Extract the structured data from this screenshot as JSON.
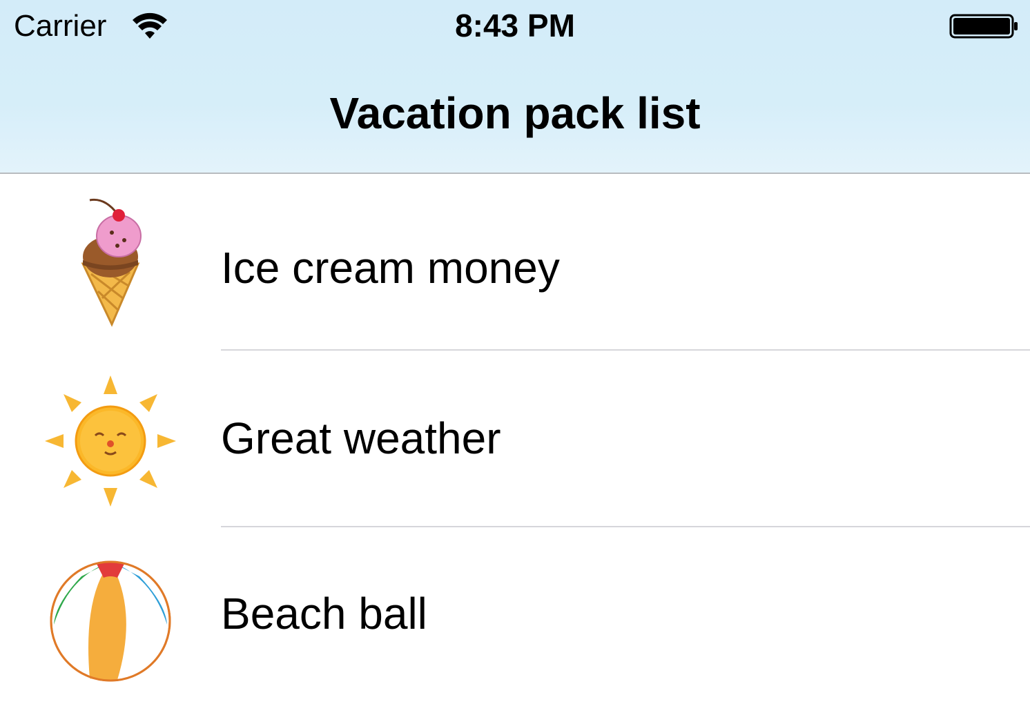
{
  "status_bar": {
    "carrier": "Carrier",
    "time": "8:43 PM",
    "wifi_icon": "wifi-icon",
    "battery_icon": "battery-icon"
  },
  "nav": {
    "title": "Vacation pack list"
  },
  "list": {
    "items": [
      {
        "label": "Ice cream money",
        "icon": "ice-cream-icon"
      },
      {
        "label": "Great weather",
        "icon": "sun-icon"
      },
      {
        "label": "Beach ball",
        "icon": "beach-ball-icon"
      }
    ]
  },
  "colors": {
    "nav_background": "#d3ecf9",
    "separator": "#d6d6da"
  }
}
